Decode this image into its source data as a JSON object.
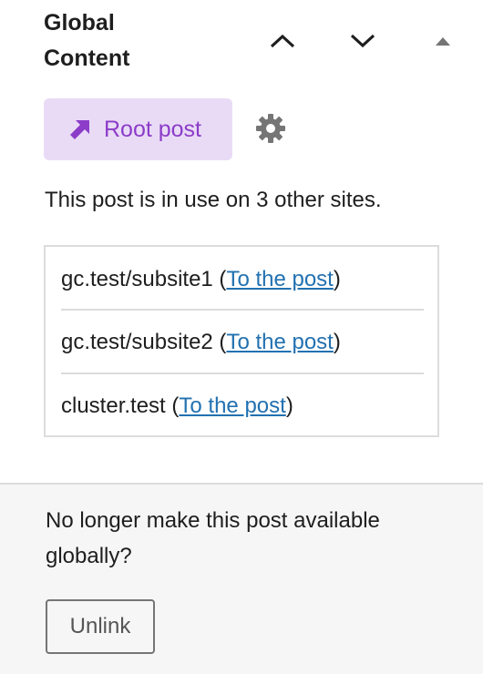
{
  "panel": {
    "title": "Global Content",
    "move_up_icon": "chevron-up-icon",
    "move_down_icon": "chevron-down-icon",
    "collapse_icon": "triangle-up-icon"
  },
  "root_post_button": {
    "label": "Root post",
    "icon": "arrow-up-right-icon",
    "background": "#e9dbf6",
    "accent": "#8c3cc8"
  },
  "settings_icon": "gear-icon",
  "usage_text": "This post is in use on 3 other sites.",
  "sites": [
    {
      "name": "gc.test/subsite1",
      "open_paren": " (",
      "link_label": "To the post",
      "close_paren": ")"
    },
    {
      "name": "gc.test/subsite2",
      "open_paren": " (",
      "link_label": "To the post",
      "close_paren": ")"
    },
    {
      "name": "cluster.test",
      "open_paren": " (",
      "link_label": "To the post",
      "close_paren": ")"
    }
  ],
  "footer": {
    "prompt": "No longer make this post available globally?",
    "unlink_label": "Unlink"
  },
  "colors": {
    "link": "#2271b1",
    "border": "#dcdcde",
    "footer_bg": "#f6f6f6"
  }
}
